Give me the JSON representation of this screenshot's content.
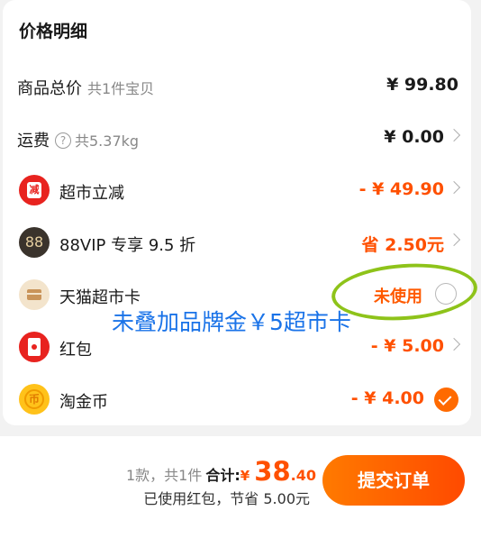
{
  "section_title": "价格明细",
  "rows": [
    {
      "label": "商品总价",
      "sub": "共1件宝贝",
      "value": "¥ 99.80"
    },
    {
      "label": "运费",
      "sub": "共5.37kg",
      "help_glyph": "?",
      "value": "¥ 0.00"
    },
    {
      "label": "超市立减",
      "icon_glyph": "减",
      "value": "- ¥ 49.90"
    },
    {
      "label": "88VIP 专享 9.5 折",
      "icon_glyph": "88",
      "value": "省 2.50元"
    },
    {
      "label": "天猫超市卡",
      "value": "未使用"
    },
    {
      "label": "红包",
      "value": "- ¥ 5.00"
    },
    {
      "label": "淘金币",
      "icon_glyph": "币",
      "value": "- ¥ 4.00"
    }
  ],
  "annotation": "未叠加品牌金￥5超市卡",
  "footer": {
    "count": "1款，共1件",
    "total_label": "合计:",
    "currency": "¥",
    "total_int": "38",
    "total_dec": ".40",
    "savings": "已使用红包，节省 5.00元",
    "submit_label": "提交订单"
  },
  "colors": {
    "accent": "#ff5000",
    "annotation": "#1a73e8",
    "highlight": "#8ec31a"
  },
  "icons": [
    "help-icon",
    "chevron-right-icon",
    "discount-icon",
    "vip88-icon",
    "supermarket-card-icon",
    "red-packet-icon",
    "gold-coin-icon",
    "radio-unchecked-icon",
    "check-circle-icon"
  ]
}
